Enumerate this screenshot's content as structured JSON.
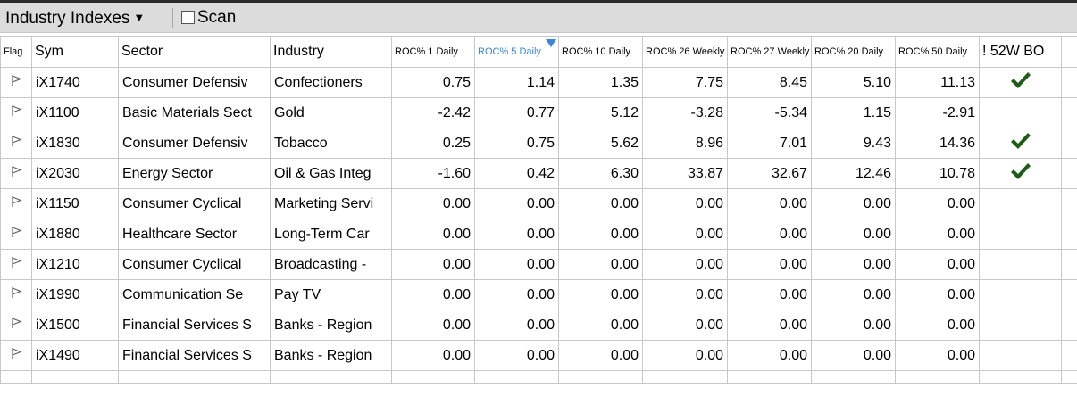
{
  "toolbar": {
    "list_label": "Industry Indexes",
    "caret": "▼",
    "scan_label": "Scan"
  },
  "columns": [
    "Flag",
    "Sym",
    "Sector",
    "Industry",
    "ROC% 1 Daily",
    "ROC% 5 Daily",
    "ROC% 10 Daily",
    "ROC% 26 Weekly",
    "ROC% 27 Weekly",
    "ROC% 20 Daily",
    "ROC% 50 Daily",
    "! 52W BO"
  ],
  "sorted_column": "ROC% 5 Daily",
  "colors": {
    "accent": "#3b86d8",
    "check": "#1f5c18",
    "toolbar_bg": "#dcdcdc",
    "grid": "#c8c8c8"
  },
  "rows": [
    {
      "sym": "iX1740",
      "sector": "Consumer Defensiv",
      "industry": "Confectioners",
      "r1d": "0.75",
      "r5d": "1.14",
      "r10d": "1.35",
      "r26w": "7.75",
      "r27w": "8.45",
      "r20d": "5.10",
      "r50d": "11.13",
      "bo": true
    },
    {
      "sym": "iX1100",
      "sector": "Basic Materials Sect",
      "industry": "Gold",
      "r1d": "-2.42",
      "r5d": "0.77",
      "r10d": "5.12",
      "r26w": "-3.28",
      "r27w": "-5.34",
      "r20d": "1.15",
      "r50d": "-2.91",
      "bo": false
    },
    {
      "sym": "iX1830",
      "sector": "Consumer Defensiv",
      "industry": "Tobacco",
      "r1d": "0.25",
      "r5d": "0.75",
      "r10d": "5.62",
      "r26w": "8.96",
      "r27w": "7.01",
      "r20d": "9.43",
      "r50d": "14.36",
      "bo": true
    },
    {
      "sym": "iX2030",
      "sector": "Energy Sector",
      "industry": "Oil & Gas Integ",
      "r1d": "-1.60",
      "r5d": "0.42",
      "r10d": "6.30",
      "r26w": "33.87",
      "r27w": "32.67",
      "r20d": "12.46",
      "r50d": "10.78",
      "bo": true
    },
    {
      "sym": "iX1150",
      "sector": "Consumer Cyclical",
      "industry": "Marketing Servi",
      "r1d": "0.00",
      "r5d": "0.00",
      "r10d": "0.00",
      "r26w": "0.00",
      "r27w": "0.00",
      "r20d": "0.00",
      "r50d": "0.00",
      "bo": false
    },
    {
      "sym": "iX1880",
      "sector": "Healthcare Sector",
      "industry": "Long-Term Car",
      "r1d": "0.00",
      "r5d": "0.00",
      "r10d": "0.00",
      "r26w": "0.00",
      "r27w": "0.00",
      "r20d": "0.00",
      "r50d": "0.00",
      "bo": false
    },
    {
      "sym": "iX1210",
      "sector": "Consumer Cyclical",
      "industry": "Broadcasting -",
      "r1d": "0.00",
      "r5d": "0.00",
      "r10d": "0.00",
      "r26w": "0.00",
      "r27w": "0.00",
      "r20d": "0.00",
      "r50d": "0.00",
      "bo": false
    },
    {
      "sym": "iX1990",
      "sector": "Communication Se",
      "industry": "Pay TV",
      "r1d": "0.00",
      "r5d": "0.00",
      "r10d": "0.00",
      "r26w": "0.00",
      "r27w": "0.00",
      "r20d": "0.00",
      "r50d": "0.00",
      "bo": false
    },
    {
      "sym": "iX1500",
      "sector": "Financial Services S",
      "industry": "Banks - Region",
      "r1d": "0.00",
      "r5d": "0.00",
      "r10d": "0.00",
      "r26w": "0.00",
      "r27w": "0.00",
      "r20d": "0.00",
      "r50d": "0.00",
      "bo": false
    },
    {
      "sym": "iX1490",
      "sector": "Financial Services S",
      "industry": "Banks - Region",
      "r1d": "0.00",
      "r5d": "0.00",
      "r10d": "0.00",
      "r26w": "0.00",
      "r27w": "0.00",
      "r20d": "0.00",
      "r50d": "0.00",
      "bo": false
    }
  ]
}
